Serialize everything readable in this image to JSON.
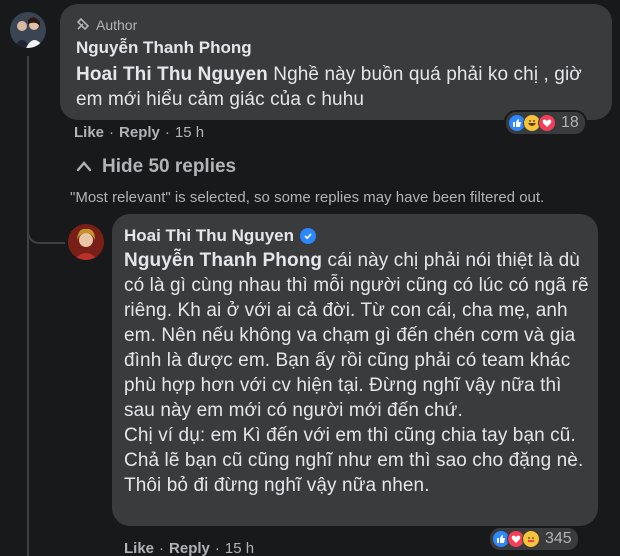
{
  "top_comment": {
    "badge_label": "Author",
    "author_name": "Nguyễn Thanh Phong",
    "mention": "Hoai Thi Thu Nguyen",
    "text": " Nghề này buồn quá phải ko chị , giờ em mới hiểu cảm giác của c huhu",
    "like_label": "Like",
    "reply_label": "Reply",
    "time": "15 h",
    "reaction_count": "18"
  },
  "thread": {
    "hide_replies_label": "Hide 50 replies",
    "filter_note": "\"Most relevant\" is selected, so some replies may have been filtered out."
  },
  "reply_comment": {
    "author_name": "Hoai Thi Thu Nguyen",
    "mention": "Nguyễn Thanh Phong",
    "text_1": " cái này chị phải nói thiệt là dù có là gì cùng nhau thì mỗi người cũng có lúc có ngã rẽ riêng. Kh ai ở với ai cả đời. Từ con cái, cha mẹ, anh em. Nên nếu không va chạm gì đến chén cơm và gia đình là được em. Bạn ấy rồi cũng phải có team khác phù hợp hơn với cv hiện tại. Đừng nghĩ vậy nữa thì sau này em mới có người mới đến chứ.",
    "text_2": "Chị ví dụ: em Kì đến với em thì cũng chia tay bạn cũ. Chả lẽ bạn cũ cũng nghĩ như em thì sao cho đặng nè. Thôi bỏ đi đừng nghĩ vậy nữa nhen.",
    "like_label": "Like",
    "reply_label": "Reply",
    "time": "15 h",
    "reaction_count": "345"
  },
  "colors": {
    "background": "#18191a",
    "bubble": "#3a3b3c",
    "text_primary": "#e4e6eb",
    "text_secondary": "#b0b3b8",
    "verified_blue": "#2d88ff"
  }
}
